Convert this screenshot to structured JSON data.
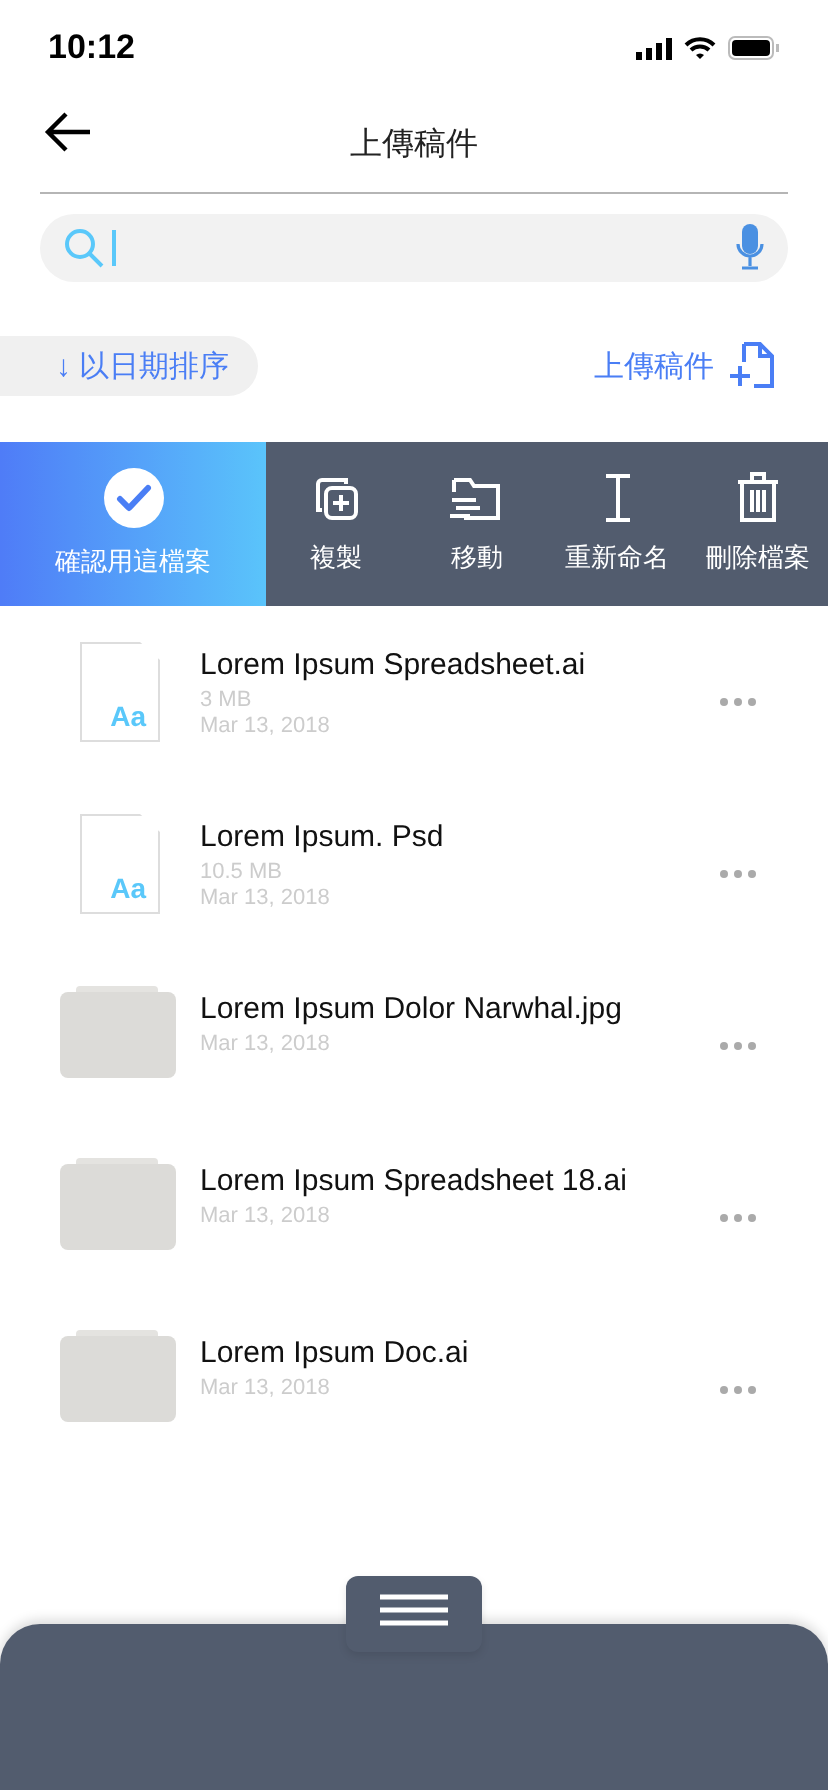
{
  "status_bar": {
    "time": "10:12"
  },
  "header": {
    "title": "上傳稿件"
  },
  "sort_button": {
    "label": "↓ 以日期排序"
  },
  "upload_button": {
    "label": "上傳稿件"
  },
  "action_bar": {
    "confirm": {
      "label": "確認用這檔案"
    },
    "actions": [
      {
        "kind": "copy",
        "label": "複製"
      },
      {
        "kind": "move",
        "label": "移動"
      },
      {
        "kind": "rename",
        "label": "重新命名"
      },
      {
        "kind": "delete",
        "label": "刪除檔案"
      }
    ]
  },
  "files": [
    {
      "kind": "document",
      "thumb_label": "Aa",
      "name": "Lorem Ipsum Spreadsheet.ai",
      "size": "3 MB",
      "date": "Mar 13, 2018"
    },
    {
      "kind": "document",
      "thumb_label": "Aa",
      "name": "Lorem Ipsum. Psd",
      "size": "10.5 MB",
      "date": "Mar 13, 2018"
    },
    {
      "kind": "folder",
      "name": "Lorem Ipsum Dolor Narwhal.jpg",
      "date": "Mar 13, 2018"
    },
    {
      "kind": "folder",
      "name": "Lorem Ipsum Spreadsheet 18.ai",
      "date": "Mar 13, 2018"
    },
    {
      "kind": "folder",
      "name": "Lorem Ipsum Doc.ai",
      "date": "Mar 13, 2018"
    }
  ]
}
